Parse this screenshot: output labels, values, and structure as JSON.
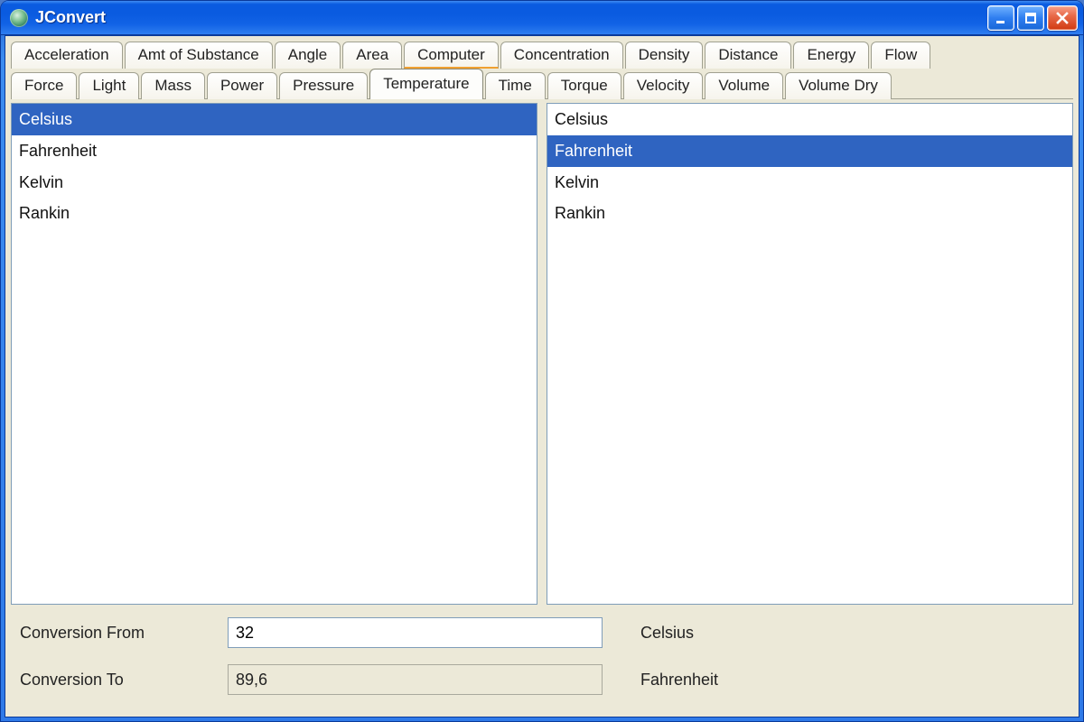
{
  "window": {
    "title": "JConvert",
    "app_icon": "jconvert-icon"
  },
  "tabs": {
    "row1": [
      "Acceleration",
      "Amt of Substance",
      "Angle",
      "Area",
      "Computer",
      "Concentration",
      "Density",
      "Distance",
      "Energy",
      "Flow"
    ],
    "row2": [
      "Force",
      "Light",
      "Mass",
      "Power",
      "Pressure",
      "Temperature",
      "Time",
      "Torque",
      "Velocity",
      "Volume",
      "Volume Dry"
    ],
    "active": "Temperature",
    "hot": "Computer"
  },
  "from_list": {
    "items": [
      "Celsius",
      "Fahrenheit",
      "Kelvin",
      "Rankin"
    ],
    "selected": "Celsius"
  },
  "to_list": {
    "items": [
      "Celsius",
      "Fahrenheit",
      "Kelvin",
      "Rankin"
    ],
    "selected": "Fahrenheit"
  },
  "conversion": {
    "from_label": "Conversion From",
    "from_value": "32",
    "from_unit": "Celsius",
    "to_label": "Conversion To",
    "to_value": "89,6",
    "to_unit": "Fahrenheit"
  },
  "colors": {
    "xp_blue": "#0a5be0",
    "selection": "#2f64c1",
    "panel": "#ece9d8"
  }
}
